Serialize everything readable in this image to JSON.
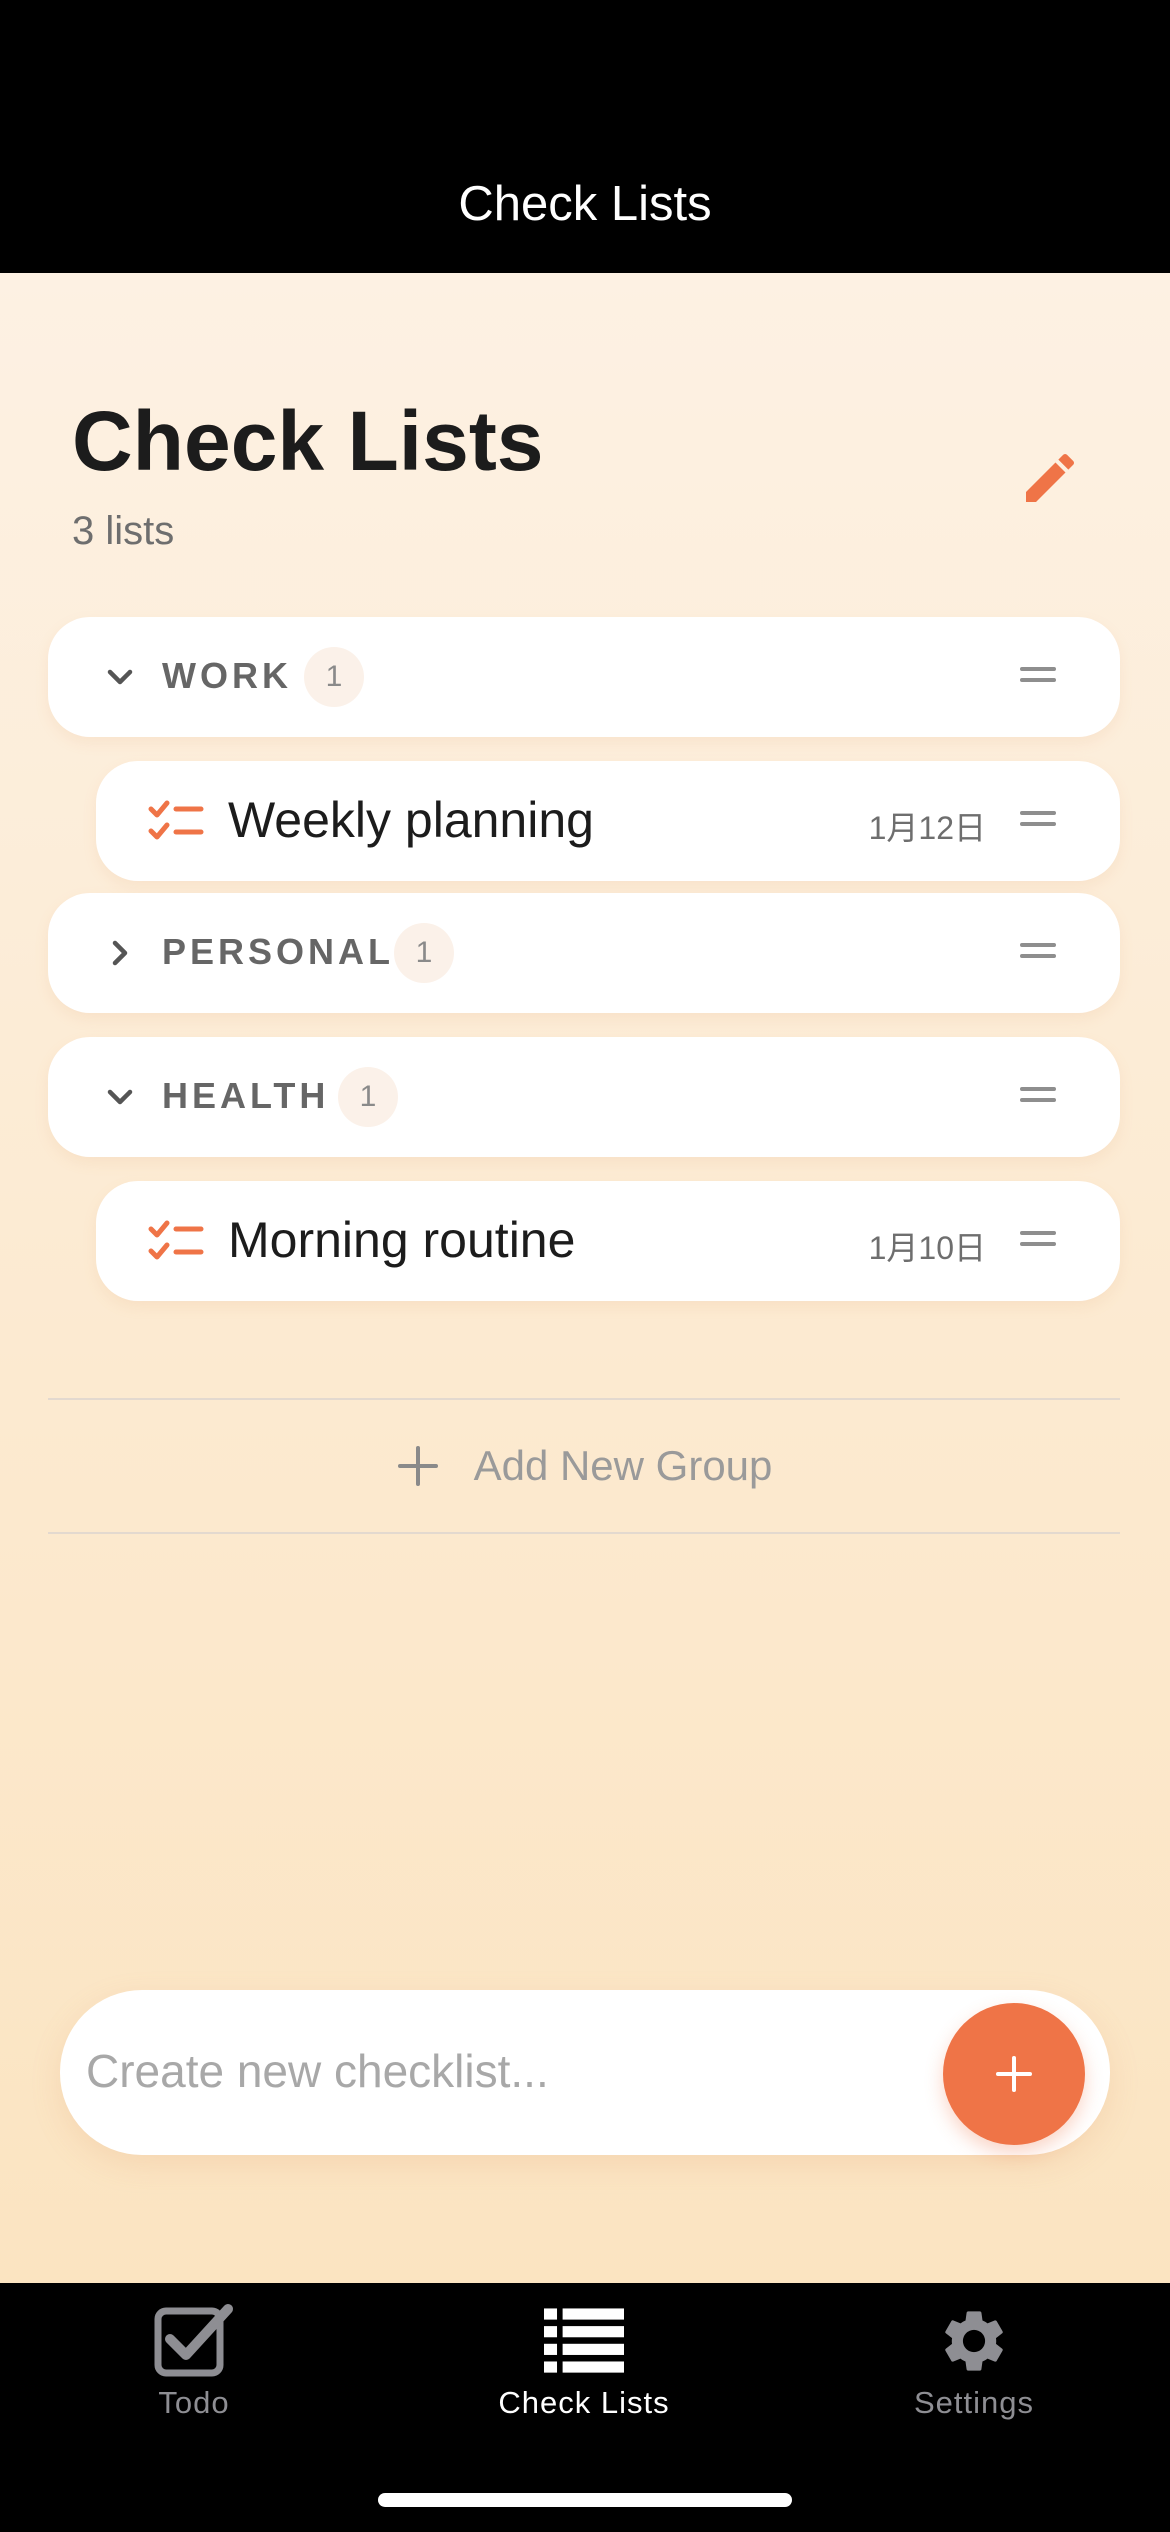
{
  "header": {
    "title": "Check Lists"
  },
  "page": {
    "title": "Check Lists",
    "subtitle": "3 lists"
  },
  "groups": [
    {
      "label": "WORK",
      "count": "1",
      "expanded": true,
      "items": [
        {
          "label": "Weekly planning",
          "date": "1月12日"
        }
      ]
    },
    {
      "label": "PERSONAL",
      "count": "1",
      "expanded": false,
      "items": []
    },
    {
      "label": "HEALTH",
      "count": "1",
      "expanded": true,
      "items": [
        {
          "label": "Morning routine",
          "date": "1月10日"
        }
      ]
    }
  ],
  "add_group": {
    "label": "Add New Group"
  },
  "composer": {
    "placeholder": "Create new checklist..."
  },
  "tabs": [
    {
      "label": "Todo",
      "icon": "checkbox-icon",
      "active": false
    },
    {
      "label": "Check Lists",
      "icon": "list-icon",
      "active": true
    },
    {
      "label": "Settings",
      "icon": "gear-icon",
      "active": false
    }
  ],
  "colors": {
    "accent": "#ef7447",
    "tab_active": "#ffffff",
    "tab_inactive": "#8e8e93"
  }
}
